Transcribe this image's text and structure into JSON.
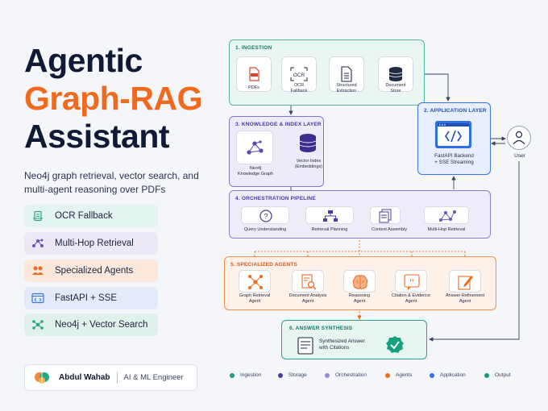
{
  "title": {
    "line1": "Agentic",
    "line2": "Graph-RAG",
    "line3": "Assistant",
    "subtitle": "Neo4j graph retrieval, vector search, and multi-agent reasoning over PDFs"
  },
  "features": [
    {
      "label": "OCR Fallback",
      "icon": "document-scan-icon",
      "color": "#2aa486"
    },
    {
      "label": "Multi-Hop Retrieval",
      "icon": "network-icon",
      "color": "#6c55b8"
    },
    {
      "label": "Specialized Agents",
      "icon": "users-icon",
      "color": "#ef6a1f"
    },
    {
      "label": "FastAPI + SSE",
      "icon": "code-window-icon",
      "color": "#3a73e0"
    },
    {
      "label": "Neo4j + Vector Search",
      "icon": "graph-icon",
      "color": "#2aa486"
    }
  ],
  "author": {
    "name": "Abdul Wahab",
    "role": "AI & ML Engineer"
  },
  "diagram": {
    "ingestion": {
      "title": "1. INGESTION",
      "nodes": [
        "PDFs",
        "OCR\nFallback",
        "Structured\nExtraction",
        "Document\nStore"
      ]
    },
    "knowledge": {
      "title": "3. KNOWLEDGE & INDEX LAYER",
      "nodes": [
        "Neo4j\nKnowledge Graph",
        "Vector Index\n(Embeddings)"
      ]
    },
    "application": {
      "title": "2. APPLICATION LAYER",
      "label": "FastAPI Backend\n+ SSE Streaming"
    },
    "orchestration": {
      "title": "4. ORCHESTRATION PIPELINE",
      "steps": [
        "Query Understanding",
        "Retrieval Planning",
        "Context Assembly",
        "Multi-Hop Retrieval"
      ]
    },
    "agents": {
      "title": "5. SPECIALIZED AGENTS",
      "items": [
        "Graph Retrieval\nAgent",
        "Document Analysis\nAgent",
        "Reasoning\nAgent",
        "Citation & Evidence\nAgent",
        "Answer Refinement\nAgent"
      ]
    },
    "synthesis": {
      "title": "6. ANSWER SYNTHESIS",
      "label": "Synthesized Answer\nwith Citations"
    },
    "user": "User"
  },
  "legend": [
    {
      "label": "Ingestion",
      "color": "#1f9a7c"
    },
    {
      "label": "Storage",
      "color": "#4a3ea8"
    },
    {
      "label": "Orchestration",
      "color": "#9a8ad8"
    },
    {
      "label": "Agents",
      "color": "#ef6a1f"
    },
    {
      "label": "Application",
      "color": "#2f6ee3"
    },
    {
      "label": "Output",
      "color": "#169a7e"
    }
  ]
}
